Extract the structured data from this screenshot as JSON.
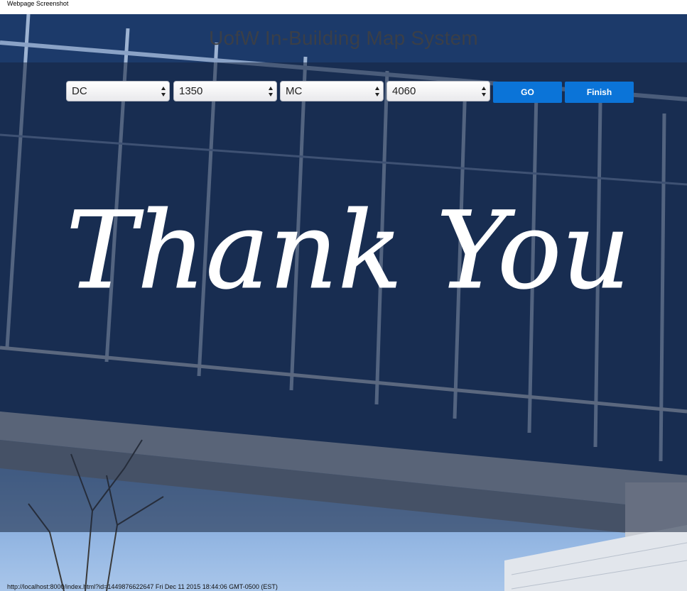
{
  "page_caption": "Webpage Screenshot",
  "header": {
    "title": "UofW In-Building Map System"
  },
  "controls": {
    "from_building": "DC",
    "from_room": "1350",
    "to_building": "MC",
    "to_room": "4060",
    "go_label": "GO",
    "finish_label": "Finish",
    "button_color": "#0b74d8"
  },
  "hero": {
    "text": "Thank You"
  },
  "status_bar": {
    "url": "http://localhost:8000/index.html?id=1449876622647 Fri Dec 11 2015 18:44:06 GMT-0500 (EST)"
  }
}
